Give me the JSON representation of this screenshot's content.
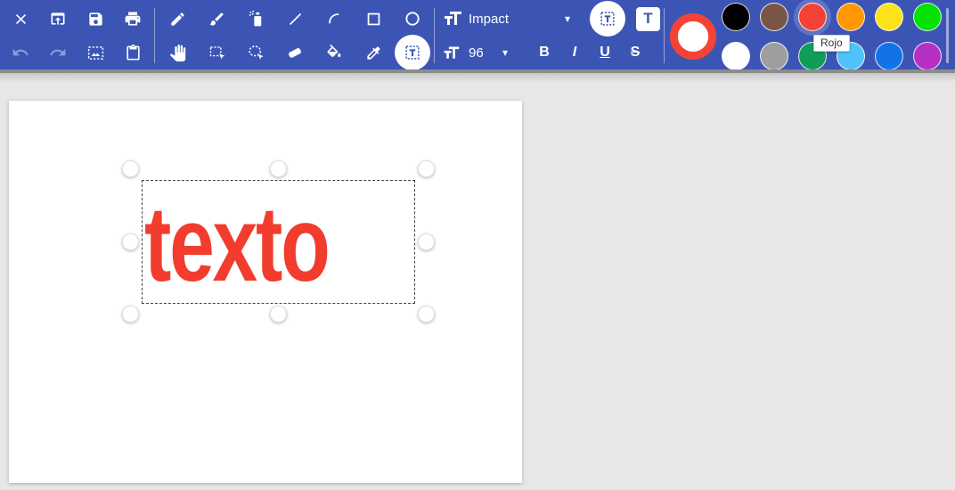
{
  "theme": {
    "toolbar_color": "#3c55b5",
    "workspace_background": "#e7e7e7",
    "icon_color": "#ffffff"
  },
  "toolbar": {
    "font_family": {
      "value": "Impact"
    },
    "font_size": {
      "value": "96"
    },
    "format": {
      "bold": "B",
      "italic": "I",
      "underline": "U",
      "strikethrough": "S"
    },
    "glyphs": {
      "caret": "▾",
      "text_button": "T"
    }
  },
  "palette": {
    "current": {
      "outline": "#f44336",
      "fill": "#ffffff"
    },
    "row1": [
      "#000000",
      "#795548",
      "#f44336",
      "#ff9800",
      "#fde21b",
      "#05e105"
    ],
    "row2": [
      "#ffffff",
      "#9e9e9e",
      "#0f9d58",
      "#4fc3f7",
      "#1273e6",
      "#b62fc5"
    ],
    "selected_color_tooltip": "Rojo"
  },
  "canvas": {
    "text": {
      "value": "texto",
      "color": "#f23c2e"
    }
  }
}
